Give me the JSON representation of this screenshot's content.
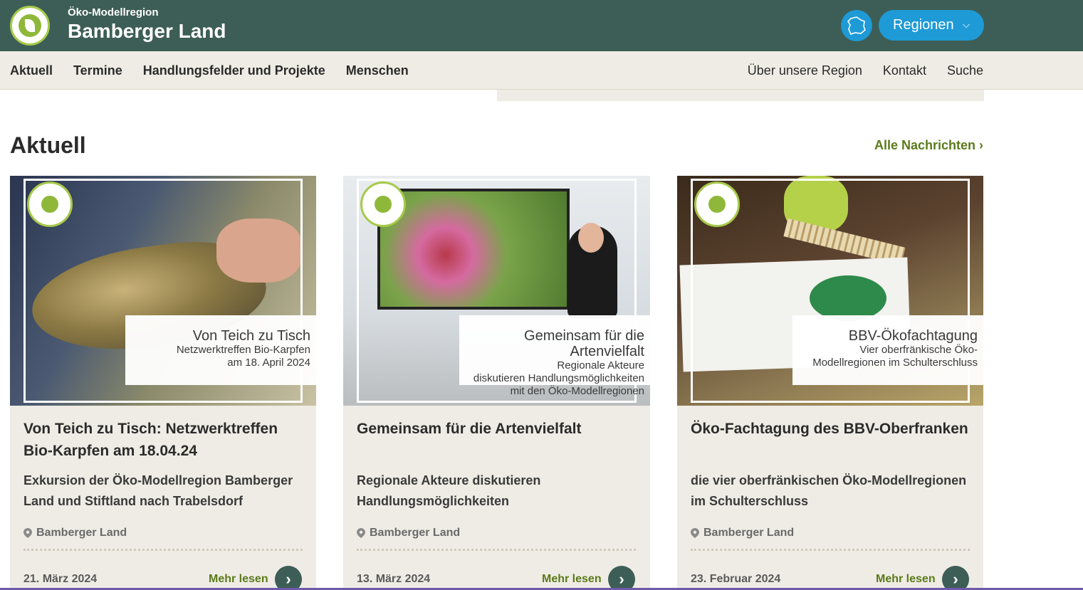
{
  "header": {
    "brand_small": "Öko-Modellregion",
    "brand_big": "Bamberger Land",
    "regionen_label": "Regionen",
    "logo_icon": "oeko-modellregionen-logo-icon",
    "map_icon": "bavaria-map-icon"
  },
  "nav": {
    "left": [
      "Aktuell",
      "Termine",
      "Handlungsfelder und Projekte",
      "Menschen"
    ],
    "right": [
      "Über unsere Region",
      "Kontakt",
      "Suche"
    ]
  },
  "section": {
    "title": "Aktuell",
    "all_news": "Alle Nachrichten ›"
  },
  "cards": [
    {
      "caption_title": "Von Teich zu Tisch",
      "caption_lines": [
        "Netzwerktreffen Bio-Karpfen",
        "am 18. April 2024"
      ],
      "title": "Von Teich zu Tisch: Netzwerktreffen Bio-Karpfen am 18.04.24",
      "subtitle": "Exkursion der Öko-Modellregion Bamberger Land und Stiftland nach Trabelsdorf",
      "location": "Bamberger Land",
      "date": "21. März 2024",
      "more": "Mehr lesen",
      "arrow": "›"
    },
    {
      "caption_title": "Gemeinsam für die Artenvielfalt",
      "caption_lines": [
        "Regionale Akteure",
        "diskutieren Handlungsmöglichkeiten",
        "mit den Öko-Modellregionen"
      ],
      "title": "Gemeinsam für die Artenvielfalt",
      "subtitle": "Regionale Akteure diskutieren Handlungsmöglichkeiten",
      "location": "Bamberger Land",
      "date": "13. März 2024",
      "more": "Mehr lesen",
      "arrow": "›"
    },
    {
      "caption_title": "BBV-Ökofachtagung",
      "caption_lines": [
        "Vier oberfränkische Öko-",
        "Modellregionen im Schulterschluss"
      ],
      "title": "Öko-Fachtagung des BBV-Oberfranken",
      "subtitle": "die vier oberfränkischen Öko-Modellregionen im Schulterschluss",
      "location": "Bamberger Land",
      "date": "23. Februar 2024",
      "more": "Mehr lesen",
      "arrow": "›"
    }
  ],
  "colors": {
    "header_bg": "#3d5e56",
    "nav_bg": "#efece5",
    "accent_blue": "#1e9ad6",
    "link_green": "#5a7a1a"
  }
}
